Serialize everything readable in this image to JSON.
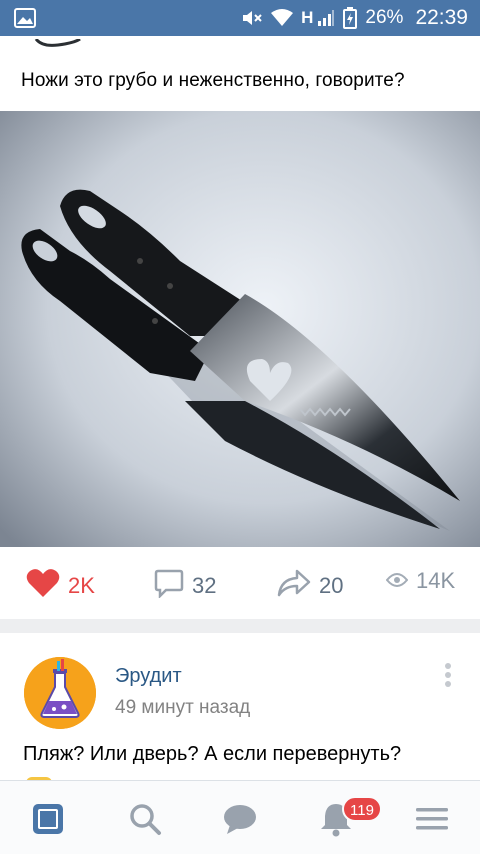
{
  "status_bar": {
    "network": "H",
    "battery": "26%",
    "time": "22:39"
  },
  "post1": {
    "text": "Ножи это грубо и неженственно, говорите?",
    "likes": "2K",
    "comments": "32",
    "shares": "20",
    "views": "14K"
  },
  "post2": {
    "author": "Эрудит",
    "time": "49 минут назад",
    "text": "Пляж? Или дверь? А если перевернуть?"
  },
  "bottom_nav": {
    "items": [
      "news-icon",
      "search-icon",
      "messages-icon",
      "notifications-icon",
      "menu-icon"
    ],
    "notifications_badge": "119"
  },
  "colors": {
    "brand": "#4a76a8",
    "like": "#e64646",
    "link": "#2a5885",
    "muted": "#828282"
  }
}
